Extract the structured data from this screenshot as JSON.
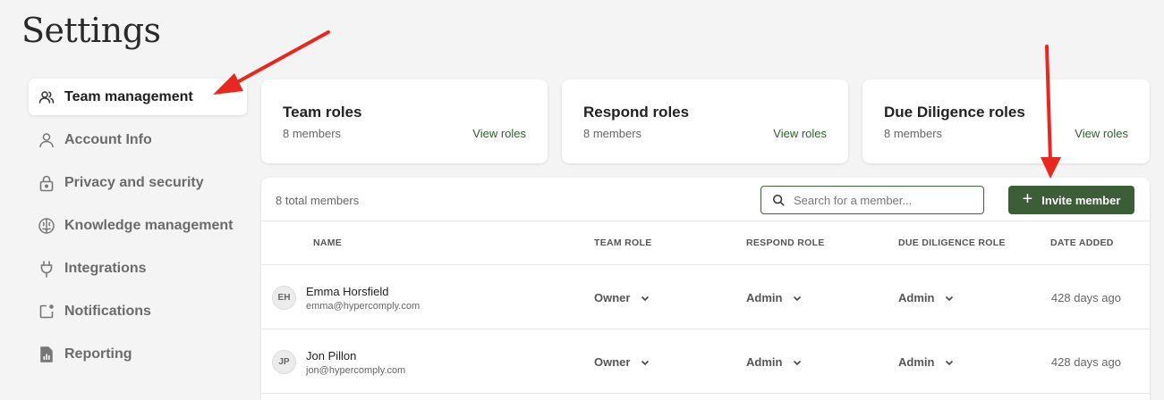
{
  "page": {
    "title": "Settings"
  },
  "sidebar": {
    "items": [
      {
        "label": "Team management",
        "icon": "users-icon"
      },
      {
        "label": "Account Info",
        "icon": "user-icon"
      },
      {
        "label": "Privacy and security",
        "icon": "lock-icon"
      },
      {
        "label": "Knowledge management",
        "icon": "brain-icon"
      },
      {
        "label": "Integrations",
        "icon": "plug-icon"
      },
      {
        "label": "Notifications",
        "icon": "notification-icon"
      },
      {
        "label": "Reporting",
        "icon": "report-icon"
      }
    ]
  },
  "roles": [
    {
      "title": "Team roles",
      "members": "8 members",
      "link": "View roles"
    },
    {
      "title": "Respond roles",
      "members": "8 members",
      "link": "View roles"
    },
    {
      "title": "Due Diligence roles",
      "members": "8 members",
      "link": "View roles"
    }
  ],
  "table": {
    "total": "8 total members",
    "search_placeholder": "Search for a member...",
    "invite_label": "Invite member",
    "columns": [
      "NAME",
      "TEAM ROLE",
      "RESPOND ROLE",
      "DUE DILIGENCE ROLE",
      "DATE ADDED"
    ],
    "rows": [
      {
        "initials": "EH",
        "name": "Emma Horsfield",
        "email": "emma@hypercomply.com",
        "team_role": "Owner",
        "respond_role": "Admin",
        "dd_role": "Admin",
        "date_added": "428 days ago"
      },
      {
        "initials": "JP",
        "name": "Jon Pillon",
        "email": "jon@hypercomply.com",
        "team_role": "Owner",
        "respond_role": "Admin",
        "dd_role": "Admin",
        "date_added": "428 days ago"
      }
    ]
  },
  "colors": {
    "accent": "#3b5e36",
    "link": "#2f5f2c",
    "annotation": "#e8281e"
  }
}
